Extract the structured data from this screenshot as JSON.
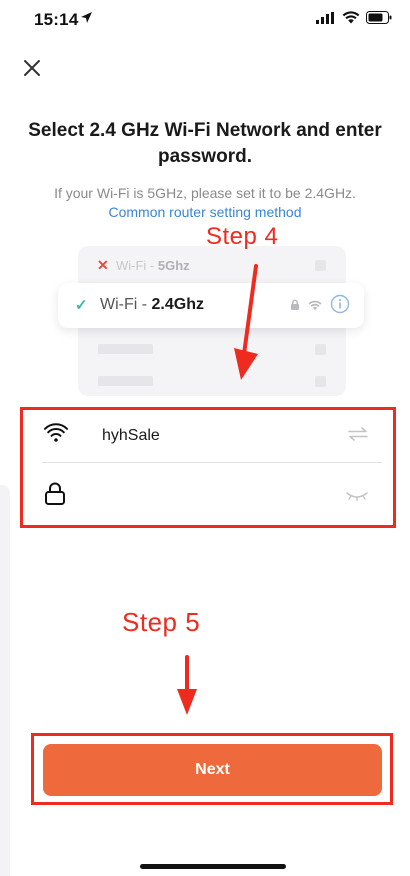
{
  "status_bar": {
    "time": "15:14"
  },
  "header": {
    "title": "Select 2.4 GHz Wi-Fi Network and enter password.",
    "subtitle": "If your Wi-Fi is 5GHz, please set it to be 2.4GHz.",
    "help_link": "Common router setting method"
  },
  "illustration": {
    "wifi_5g_prefix": "Wi-Fi - ",
    "wifi_5g_band": "5Ghz",
    "wifi_24g_prefix": "Wi-Fi - ",
    "wifi_24g_band": "2.4Ghz"
  },
  "annotations": {
    "step4": "Step 4",
    "step5": "Step 5",
    "color": "#ee2b1f"
  },
  "form": {
    "ssid": "hyhSale",
    "password": ""
  },
  "actions": {
    "next_label": "Next",
    "next_color": "#ee6a3d"
  },
  "icons": [
    "location-arrow-icon",
    "signal-icon",
    "wifi-icon",
    "battery-icon",
    "close-icon",
    "lock-icon",
    "info-icon",
    "swap-icon",
    "eye-closed-icon",
    "arrow-down-icon"
  ]
}
